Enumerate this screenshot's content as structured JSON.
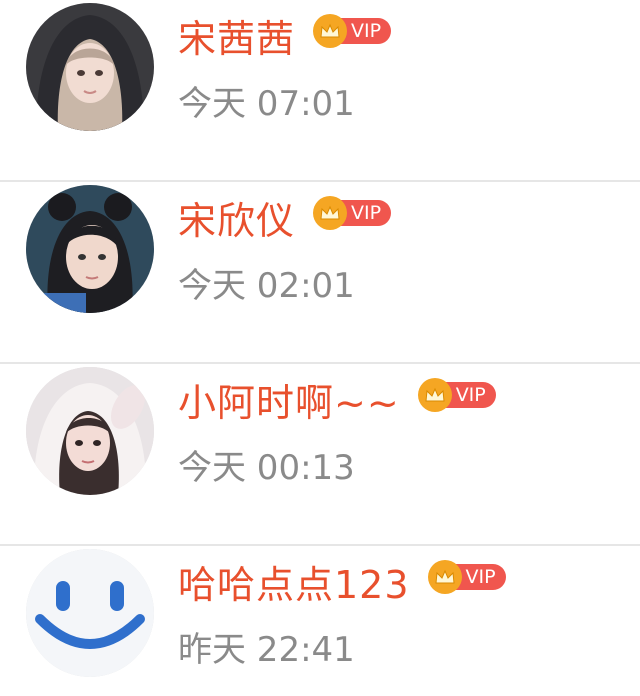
{
  "conversations": [
    {
      "name": "宋茜茜",
      "time": "今天 07:01",
      "vip_label": "VIP",
      "avatar_icon": "avatar-hooded-girl-icon"
    },
    {
      "name": "宋欣仪",
      "time": "今天 02:01",
      "vip_label": "VIP",
      "avatar_icon": "avatar-bun-hair-girl-icon"
    },
    {
      "name": "小阿时啊~~",
      "time": "今天 00:13",
      "vip_label": "VIP",
      "avatar_icon": "avatar-bunny-hood-girl-icon"
    },
    {
      "name": "哈哈点点123",
      "time": "昨天 22:41",
      "vip_label": "VIP",
      "avatar_icon": "smiley-face-icon"
    }
  ],
  "colors": {
    "name": "#e8502d",
    "time": "#8a8a8a",
    "vip_crown": "#f5a623",
    "vip_tag": "#f0564e",
    "divider": "#e6e6e6"
  }
}
